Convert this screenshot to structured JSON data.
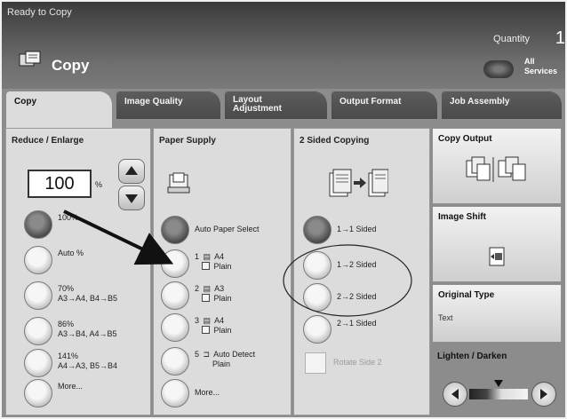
{
  "header": {
    "status": "Ready to Copy",
    "quantity_label": "Quantity",
    "quantity_value": "1",
    "title": "Copy",
    "services_label": "All Services"
  },
  "tabs": [
    {
      "label": "Copy",
      "active": true
    },
    {
      "label": "Image Quality",
      "active": false
    },
    {
      "label": "Layout Adjustment",
      "active": false
    },
    {
      "label": "Output Format",
      "active": false
    },
    {
      "label": "Job Assembly",
      "active": false
    }
  ],
  "reduce_enlarge": {
    "title": "Reduce / Enlarge",
    "value": "100",
    "unit": "%",
    "options": [
      {
        "label": "100%",
        "selected": true
      },
      {
        "label": "Auto %",
        "selected": false
      },
      {
        "line1": "70%",
        "line2": "A3→A4, B4→B5",
        "selected": false
      },
      {
        "line1": "86%",
        "line2": "A3→B4, A4→B5",
        "selected": false
      },
      {
        "line1": "141%",
        "line2": "A4→A3, B5→B4",
        "selected": false
      },
      {
        "label": "More...",
        "selected": false
      }
    ]
  },
  "paper_supply": {
    "title": "Paper Supply",
    "options": [
      {
        "label": "Auto Paper Select",
        "selected": true
      },
      {
        "tray": "1",
        "size": "A4",
        "media": "Plain",
        "selected": false
      },
      {
        "tray": "2",
        "size": "A3",
        "media": "Plain",
        "selected": false
      },
      {
        "tray": "3",
        "size": "A4",
        "media": "Plain",
        "selected": false
      },
      {
        "tray": "5",
        "size": "Auto Detect",
        "media": "Plain",
        "selected": false
      },
      {
        "label": "More...",
        "selected": false
      }
    ]
  },
  "two_sided": {
    "title": "2 Sided Copying",
    "options": [
      {
        "label": "1→1 Sided",
        "selected": true
      },
      {
        "label": "1→2 Sided",
        "selected": false
      },
      {
        "label": "2→2 Sided",
        "selected": false
      },
      {
        "label": "2→1 Sided",
        "selected": false
      }
    ],
    "rotate_label": "Rotate Side 2"
  },
  "right_panel": {
    "copy_output": "Copy Output",
    "image_shift": "Image Shift",
    "original_type": "Original Type",
    "original_type_value": "Text",
    "lighten_darken": "Lighten / Darken",
    "lighten_darken_level": 0.5
  }
}
